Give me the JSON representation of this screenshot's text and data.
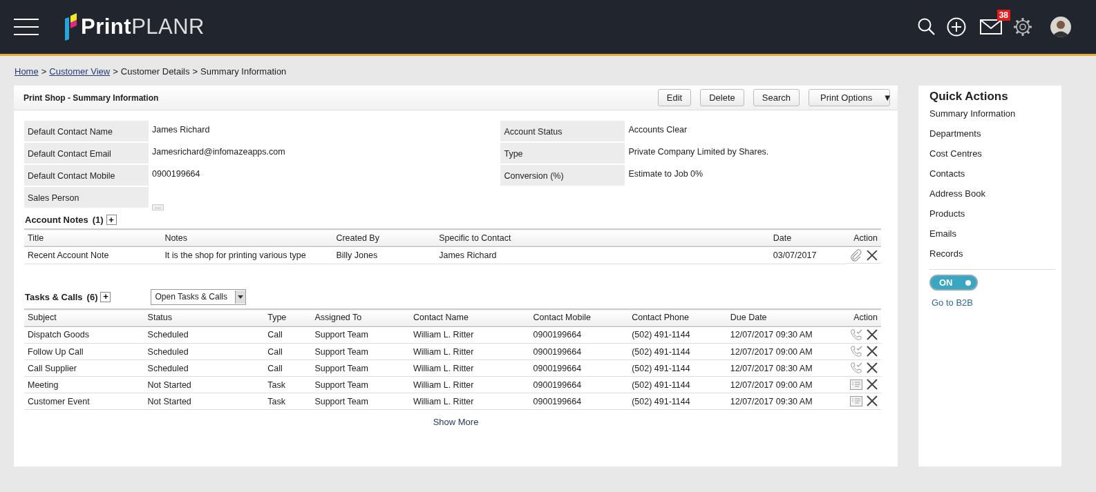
{
  "header": {
    "logo": {
      "bold": "Print",
      "light": "PLANR"
    },
    "mail_badge": "38"
  },
  "breadcrumb": [
    {
      "label": "Home",
      "link": true
    },
    {
      "label": "Customer View",
      "link": true
    },
    {
      "label": "Customer Details",
      "link": false
    },
    {
      "label": "Summary Information",
      "link": false
    }
  ],
  "breadcrumb_separator": ">",
  "panel": {
    "title": "Print Shop - Summary Information",
    "buttons": [
      "Edit",
      "Delete",
      "Search"
    ],
    "print_options": "Print Options",
    "dropdown_arrow": "▼"
  },
  "details_left": [
    {
      "label": "Default Contact Name",
      "value": "James Richard"
    },
    {
      "label": "Default Contact Email",
      "value": "Jamesrichard@infomazeapps.com"
    },
    {
      "label": "Default Contact Mobile",
      "value": "0900199664"
    },
    {
      "label": "Sales Person",
      "more": "···"
    }
  ],
  "details_right": [
    {
      "label": "Account Status",
      "value": "Accounts Clear"
    },
    {
      "label": "Type",
      "value": "Private Company Limited by Shares."
    },
    {
      "label": "Conversion (%)",
      "value": "Estimate to Job 0%"
    }
  ],
  "account_notes": {
    "title": "Account Notes",
    "count": "(1)",
    "add": "+",
    "columns": [
      "Title",
      "Notes",
      "Created By",
      "Specific to Contact",
      "Date",
      "Action"
    ],
    "rows": [
      {
        "title": "Recent Account Note",
        "notes": "It is the shop for printing various type",
        "created_by": "Billy Jones",
        "contact": "James Richard",
        "date": "03/07/2017"
      }
    ]
  },
  "tasks": {
    "title": "Tasks & Calls",
    "count": "(6)",
    "add": "+",
    "filter": "Open  Tasks & Calls",
    "columns": [
      "Subject",
      "Status",
      "Type",
      "Assigned To",
      "Contact Name",
      "Contact Mobile",
      "Contact Phone",
      "Due Date",
      "Action"
    ],
    "rows": [
      {
        "kind": "call",
        "cells": [
          "Dispatch Goods",
          "Scheduled",
          "Call",
          "Support Team",
          "William L. Ritter",
          "0900199664",
          "(502) 491-1144",
          "12/07/2017 09:30 AM"
        ]
      },
      {
        "kind": "call",
        "cells": [
          "Follow Up Call",
          "Scheduled",
          "Call",
          "Support Team",
          "William L. Ritter",
          "0900199664",
          "(502) 491-1144",
          "12/07/2017 09:00 AM"
        ]
      },
      {
        "kind": "call",
        "cells": [
          "Call Supplier",
          "Scheduled",
          "Call",
          "Support Team",
          "William L. Ritter",
          "0900199664",
          "(502) 491-1144",
          "12/07/2017 08:30 AM"
        ]
      },
      {
        "kind": "task",
        "cells": [
          "Meeting",
          "Not Started",
          "Task",
          "Support Team",
          "William L. Ritter",
          "0900199664",
          "(502) 491-1144",
          "12/07/2017 09:00 AM"
        ]
      },
      {
        "kind": "task",
        "cells": [
          "Customer Event",
          "Not Started",
          "Task",
          "Support Team",
          "William L. Ritter",
          "0900199664",
          "(502) 491-1144",
          "12/07/2017 09:30 AM"
        ]
      }
    ],
    "show_more": "Show More"
  },
  "quick_actions": {
    "title": "Quick Actions",
    "items": [
      "Summary Information",
      "Departments",
      "Cost Centres",
      "Contacts",
      "Address Book",
      "Products",
      "Emails",
      "Records"
    ],
    "toggle": {
      "label": "ON",
      "on": true
    },
    "b2b_link": "Go to B2B"
  }
}
